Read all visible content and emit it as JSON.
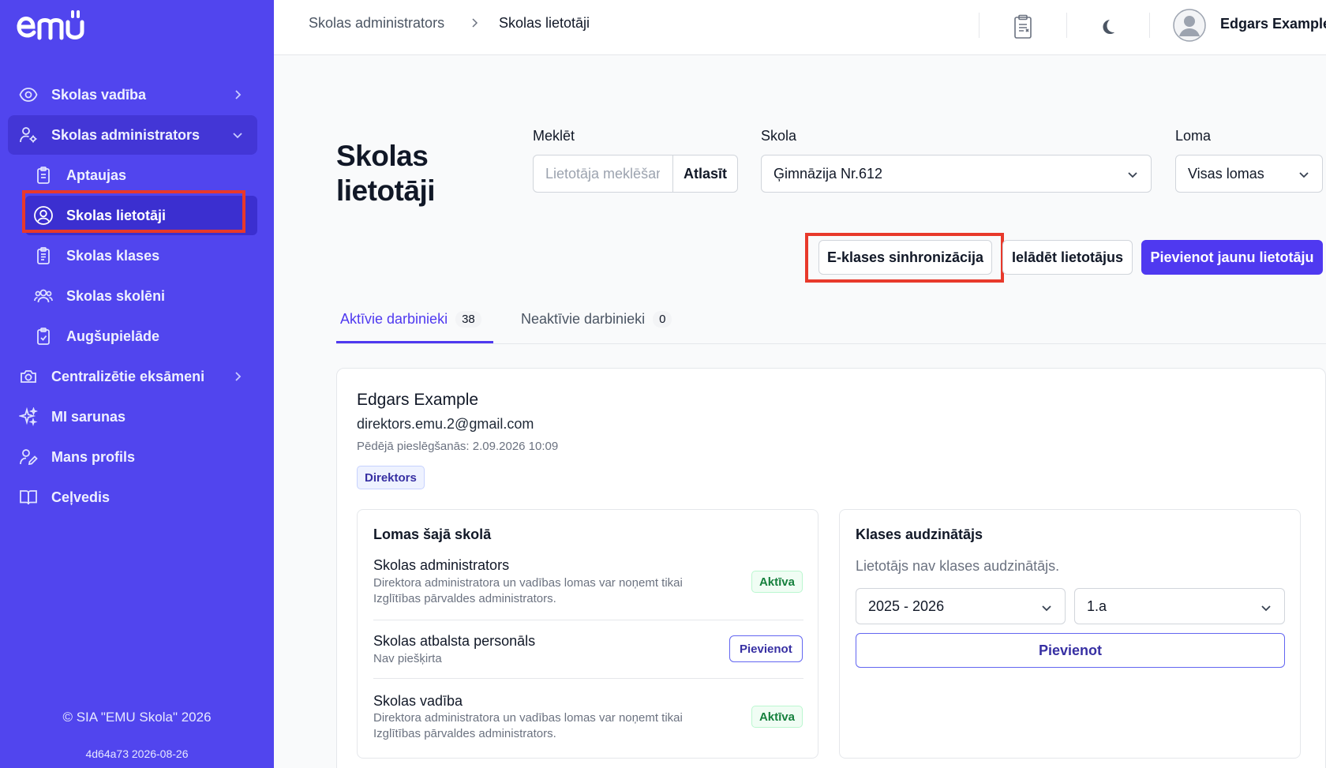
{
  "colors": {
    "sidebar": "#5145ee",
    "primary": "#4f39f0",
    "highlight": "#e8392b"
  },
  "sidebar": {
    "logo": "emu",
    "items": [
      {
        "label": "Skolas vadība",
        "icon": "eye-icon"
      },
      {
        "label": "Skolas administrators",
        "icon": "users-gear-icon"
      },
      {
        "label": "Aptaujas",
        "icon": "clipboard-icon"
      },
      {
        "label": "Skolas lietotāji",
        "icon": "user-circle-icon"
      },
      {
        "label": "Skolas klases",
        "icon": "clipboard-list-icon"
      },
      {
        "label": "Skolas skolēni",
        "icon": "users-icon"
      },
      {
        "label": "Augšupielāde",
        "icon": "clipboard-check-icon"
      },
      {
        "label": "Centralizētie eksāmeni",
        "icon": "camera-gear-icon"
      },
      {
        "label": "MI sarunas",
        "icon": "sparkles-icon"
      },
      {
        "label": "Mans profils",
        "icon": "user-edit-icon"
      },
      {
        "label": "Ceļvedis",
        "icon": "book-icon"
      }
    ],
    "copyright": "© SIA \"EMU Skola\" 2026",
    "version": "4d64a73 2026-08-26"
  },
  "header": {
    "breadcrumb": [
      "Skolas administrators",
      "Skolas lietotāji"
    ],
    "user_name": "Edgars Example"
  },
  "main": {
    "title": "Skolas lietotāji",
    "search": {
      "label": "Meklēt",
      "placeholder": "Lietotāja meklēšana",
      "button": "Atlasīt"
    },
    "school": {
      "label": "Skola",
      "value": "Ģimnāzija Nr.612"
    },
    "role": {
      "label": "Loma",
      "value": "Visas lomas"
    },
    "actions": {
      "sync": "E-klases sinhronizācija",
      "load": "Ielādēt lietotājus",
      "add": "Pievienot jaunu lietotāju"
    },
    "tabs": [
      {
        "label": "Aktīvie darbinieki",
        "count": "38"
      },
      {
        "label": "Neaktīvie darbinieki",
        "count": "0"
      }
    ],
    "user_card": {
      "name": "Edgars Example",
      "email": "direktors.emu.2@gmail.com",
      "last_login": "Pēdējā pieslēgšanās: 2.09.2026 10:09",
      "role_badge": "Direktors",
      "roles_section": {
        "title": "Lomas šajā skolā",
        "roles": [
          {
            "name": "Skolas administrators",
            "desc": "Direktora administratora un vadības lomas var noņemt tikai Izglītības pārvaldes administrators.",
            "status": "Aktīva"
          },
          {
            "name": "Skolas atbalsta personāls",
            "desc": "Nav piešķirta",
            "action": "Pievienot"
          },
          {
            "name": "Skolas vadība",
            "desc": "Direktora administratora un vadības lomas var noņemt tikai Izglītības pārvaldes administrators.",
            "status": "Aktīva"
          }
        ]
      },
      "class_teacher": {
        "title": "Klases audzinātājs",
        "hint": "Lietotājs nav klases audzinātājs.",
        "year": "2025 - 2026",
        "class": "1.a",
        "add_button": "Pievienot"
      }
    }
  }
}
